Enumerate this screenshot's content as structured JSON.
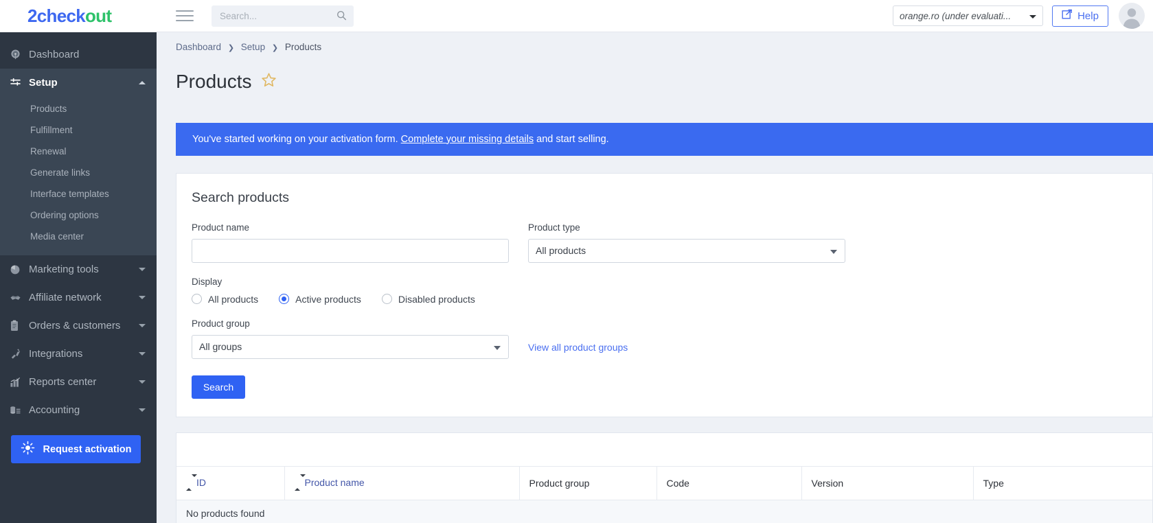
{
  "topbar": {
    "logo_blue": "2check",
    "logo_green": "out",
    "menu_icon": "hamburger-icon",
    "search_placeholder": "Search...",
    "search_value": "",
    "account_label": "orange.ro (under evaluati...",
    "help_label": "Help",
    "avatar_label": "user-avatar"
  },
  "sidebar": {
    "dashboard": {
      "label": "Dashboard",
      "icon": "speedometer-icon"
    },
    "setup": {
      "label": "Setup",
      "icon": "sliders-icon",
      "expanded": true
    },
    "setup_items": [
      {
        "label": "Products"
      },
      {
        "label": "Fulfillment"
      },
      {
        "label": "Renewal"
      },
      {
        "label": "Generate links"
      },
      {
        "label": "Interface templates"
      },
      {
        "label": "Ordering options"
      },
      {
        "label": "Media center"
      }
    ],
    "groups": [
      {
        "label": "Marketing tools",
        "icon": "pie-chart-icon"
      },
      {
        "label": "Affiliate network",
        "icon": "handshake-icon"
      },
      {
        "label": "Orders & customers",
        "icon": "clipboard-icon"
      },
      {
        "label": "Integrations",
        "icon": "plug-icon"
      },
      {
        "label": "Reports center",
        "icon": "bar-chart-icon"
      },
      {
        "label": "Accounting",
        "icon": "coins-icon"
      }
    ],
    "activation_button": "Request activation"
  },
  "breadcrumb": {
    "items": [
      "Dashboard",
      "Setup",
      "Products"
    ],
    "separator": "❯"
  },
  "page": {
    "title": "Products",
    "favorite_icon": "star-outline-icon"
  },
  "banner": {
    "text_before": "You've started working on your activation form.",
    "link": "Complete your missing details",
    "text_after": "and start selling."
  },
  "search_card": {
    "title": "Search products",
    "product_name_label": "Product name",
    "product_name_value": "",
    "product_type_label": "Product type",
    "product_type_value": "All products",
    "display_label": "Display",
    "display_options": [
      {
        "label": "All products",
        "selected": false
      },
      {
        "label": "Active products",
        "selected": true
      },
      {
        "label": "Disabled products",
        "selected": false
      }
    ],
    "product_group_label": "Product group",
    "product_group_value": "All groups",
    "view_all_link": "View all product groups",
    "search_button": "Search"
  },
  "table": {
    "columns": [
      {
        "label": "ID",
        "sortable": true
      },
      {
        "label": "Product name",
        "sortable": true
      },
      {
        "label": "Product group",
        "sortable": false
      },
      {
        "label": "Code",
        "sortable": false
      },
      {
        "label": "Version",
        "sortable": false
      },
      {
        "label": "Type",
        "sortable": false
      }
    ],
    "empty_message": "No products found"
  },
  "colors": {
    "brand_blue": "#3d68f0",
    "brand_green": "#2ec26a",
    "accent": "#2f62f3",
    "banner_bg": "#3a6af0",
    "sidebar_bg": "#2d3642",
    "sidebar_active_bg": "#3a4654",
    "page_bg": "#eef1f6",
    "star": "#e0b863"
  }
}
